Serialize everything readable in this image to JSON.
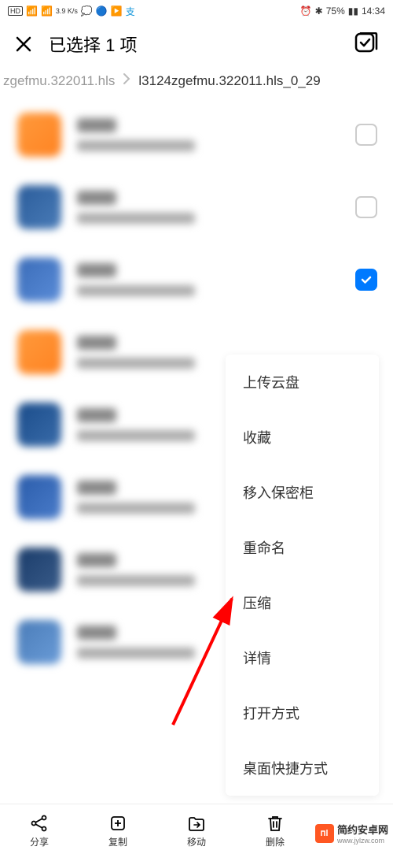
{
  "status": {
    "hd": "HD",
    "net_speed": "3.9\nK/s",
    "battery": "75%",
    "time": "14:34"
  },
  "header": {
    "title": "已选择 1 项"
  },
  "breadcrumb": {
    "parent": "zgefmu.322011.hls",
    "current": "l3124zgefmu.322011.hls_0_29"
  },
  "files": [
    {
      "checked": false,
      "cls": "orange"
    },
    {
      "checked": false,
      "cls": "blue1"
    },
    {
      "checked": true,
      "cls": "blue2"
    },
    {
      "checked": false,
      "cls": "orange"
    },
    {
      "checked": false,
      "cls": "blue3"
    },
    {
      "checked": false,
      "cls": "blue4"
    },
    {
      "checked": false,
      "cls": "blue5"
    },
    {
      "checked": false,
      "cls": "blue6"
    }
  ],
  "menu": {
    "items": [
      "上传云盘",
      "收藏",
      "移入保密柜",
      "重命名",
      "压缩",
      "详情",
      "打开方式",
      "桌面快捷方式"
    ]
  },
  "bottom": {
    "share": "分享",
    "copy": "复制",
    "move": "移动",
    "delete": "删除"
  },
  "watermark": {
    "text": "简约安卓网",
    "url": "www.jylzw.com"
  }
}
